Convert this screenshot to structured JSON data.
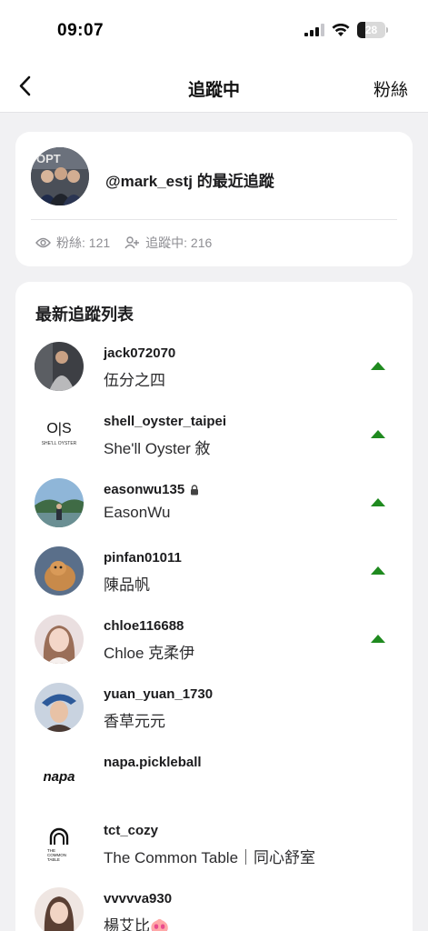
{
  "status_bar": {
    "time": "09:07",
    "battery": "28",
    "battery_level": 0.28
  },
  "nav": {
    "title": "追蹤中",
    "right_label": "粉絲"
  },
  "profile": {
    "title": "@mark_estj 的最近追蹤",
    "followers_label": "粉絲: 121",
    "following_label": "追蹤中: 216"
  },
  "list": {
    "title": "最新追蹤列表",
    "items": [
      {
        "username": "jack072070",
        "name": "伍分之四",
        "private": false,
        "trend": "up"
      },
      {
        "username": "shell_oyster_taipei",
        "name": "She'll Oyster 敘",
        "private": false,
        "trend": "up"
      },
      {
        "username": "easonwu135",
        "name": "EasonWu",
        "private": true,
        "trend": "up"
      },
      {
        "username": "pinfan01011",
        "name": "陳品帆",
        "private": false,
        "trend": "up"
      },
      {
        "username": "chloe116688",
        "name": "Chloe 克柔伊",
        "private": false,
        "trend": "up"
      },
      {
        "username": "yuan_yuan_1730",
        "name": "香草元元",
        "private": false,
        "trend": ""
      },
      {
        "username": "napa.pickleball",
        "name": "",
        "private": false,
        "trend": ""
      },
      {
        "username": "tct_cozy",
        "name": "The Common Table｜同心舒室",
        "private": false,
        "trend": ""
      },
      {
        "username": "vvvvva930",
        "name": "楊艾比🐽",
        "private": false,
        "trend": ""
      }
    ]
  },
  "logos": {
    "shell_oyster": "O|S",
    "shell_oyster_sub": "SHE'LL OYSTER",
    "napa": "napa",
    "tct_line1": "THE",
    "tct_line2": "COMMON",
    "tct_line3": "TABLE"
  },
  "colors": {
    "accent_up": "#1f8a1f",
    "muted": "#8e8e93",
    "background": "#f1f1f3"
  }
}
